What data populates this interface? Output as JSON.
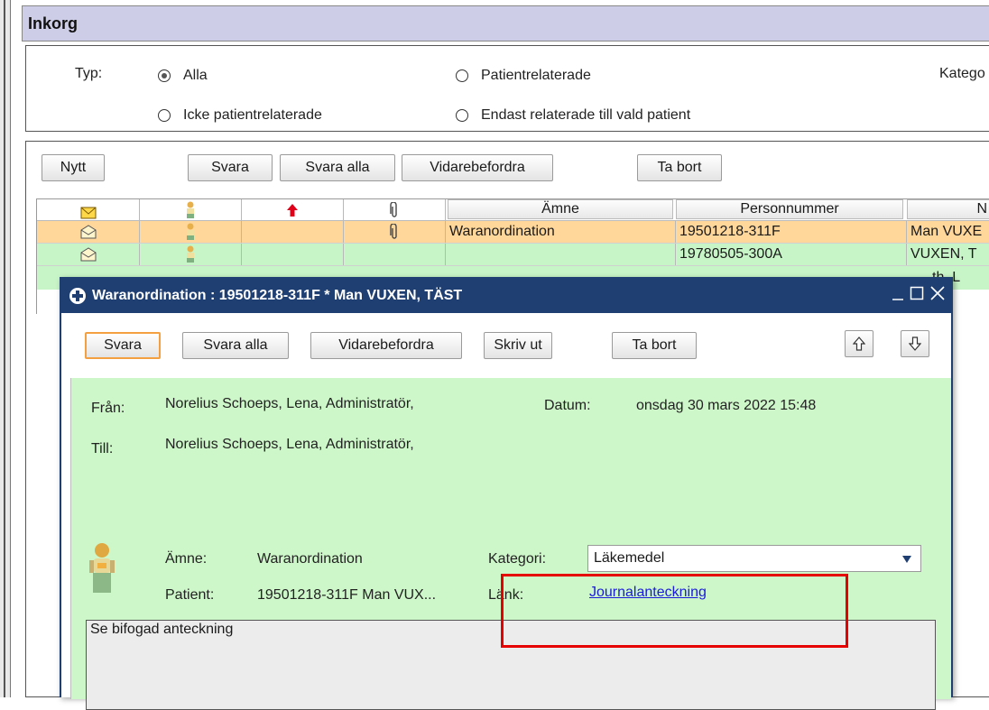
{
  "inbox": {
    "title": "Inkorg",
    "filter": {
      "type_label": "Typ:",
      "options": [
        "Alla",
        "Patientrelaterade",
        "Icke patientrelaterade",
        "Endast relaterade till vald patient"
      ],
      "selected": "Alla",
      "category_label": "Katego"
    },
    "toolbar": {
      "new": "Nytt",
      "reply": "Svara",
      "reply_all": "Svara alla",
      "forward": "Vidarebefordra",
      "delete": "Ta bort"
    },
    "table": {
      "headers": {
        "subject": "Ämne",
        "personnummer": "Personnummer",
        "name": "N"
      },
      "rows": [
        {
          "subject": "Waranordination",
          "personnummer": "19501218-311F",
          "name": "Man VUXE"
        },
        {
          "subject": "",
          "personnummer": "19780505-300A",
          "name": "VUXEN, T"
        },
        {
          "subject": "",
          "personnummer": "",
          "name": "th, L"
        }
      ]
    }
  },
  "dialog": {
    "title": "Waranordination : 19501218-311F * Man VUXEN, TÄST",
    "toolbar": {
      "reply": "Svara",
      "reply_all": "Svara alla",
      "forward": "Vidarebefordra",
      "print": "Skriv ut",
      "delete": "Ta bort"
    },
    "from_label": "Från:",
    "from": "Norelius Schoeps, Lena, Administratör,",
    "date_label": "Datum:",
    "date": "onsdag 30 mars 2022 15:48",
    "to_label": "Till:",
    "to": "Norelius Schoeps, Lena, Administratör,",
    "subject_label": "Ämne:",
    "subject": "Waranordination",
    "category_label": "Kategori:",
    "category": "Läkemedel",
    "patient_label": "Patient:",
    "patient": "19501218-311F Man VUX...",
    "link_label": "Länk:",
    "link": "Journalanteckning",
    "body": "Se bifogad anteckning"
  },
  "colors": {
    "header_bg": "#cdcde8",
    "selected_row": "#ffd79a",
    "green_row": "#c8f5c8",
    "dialog_title_bg": "#1f3f73",
    "highlight_box": "#e60000"
  }
}
